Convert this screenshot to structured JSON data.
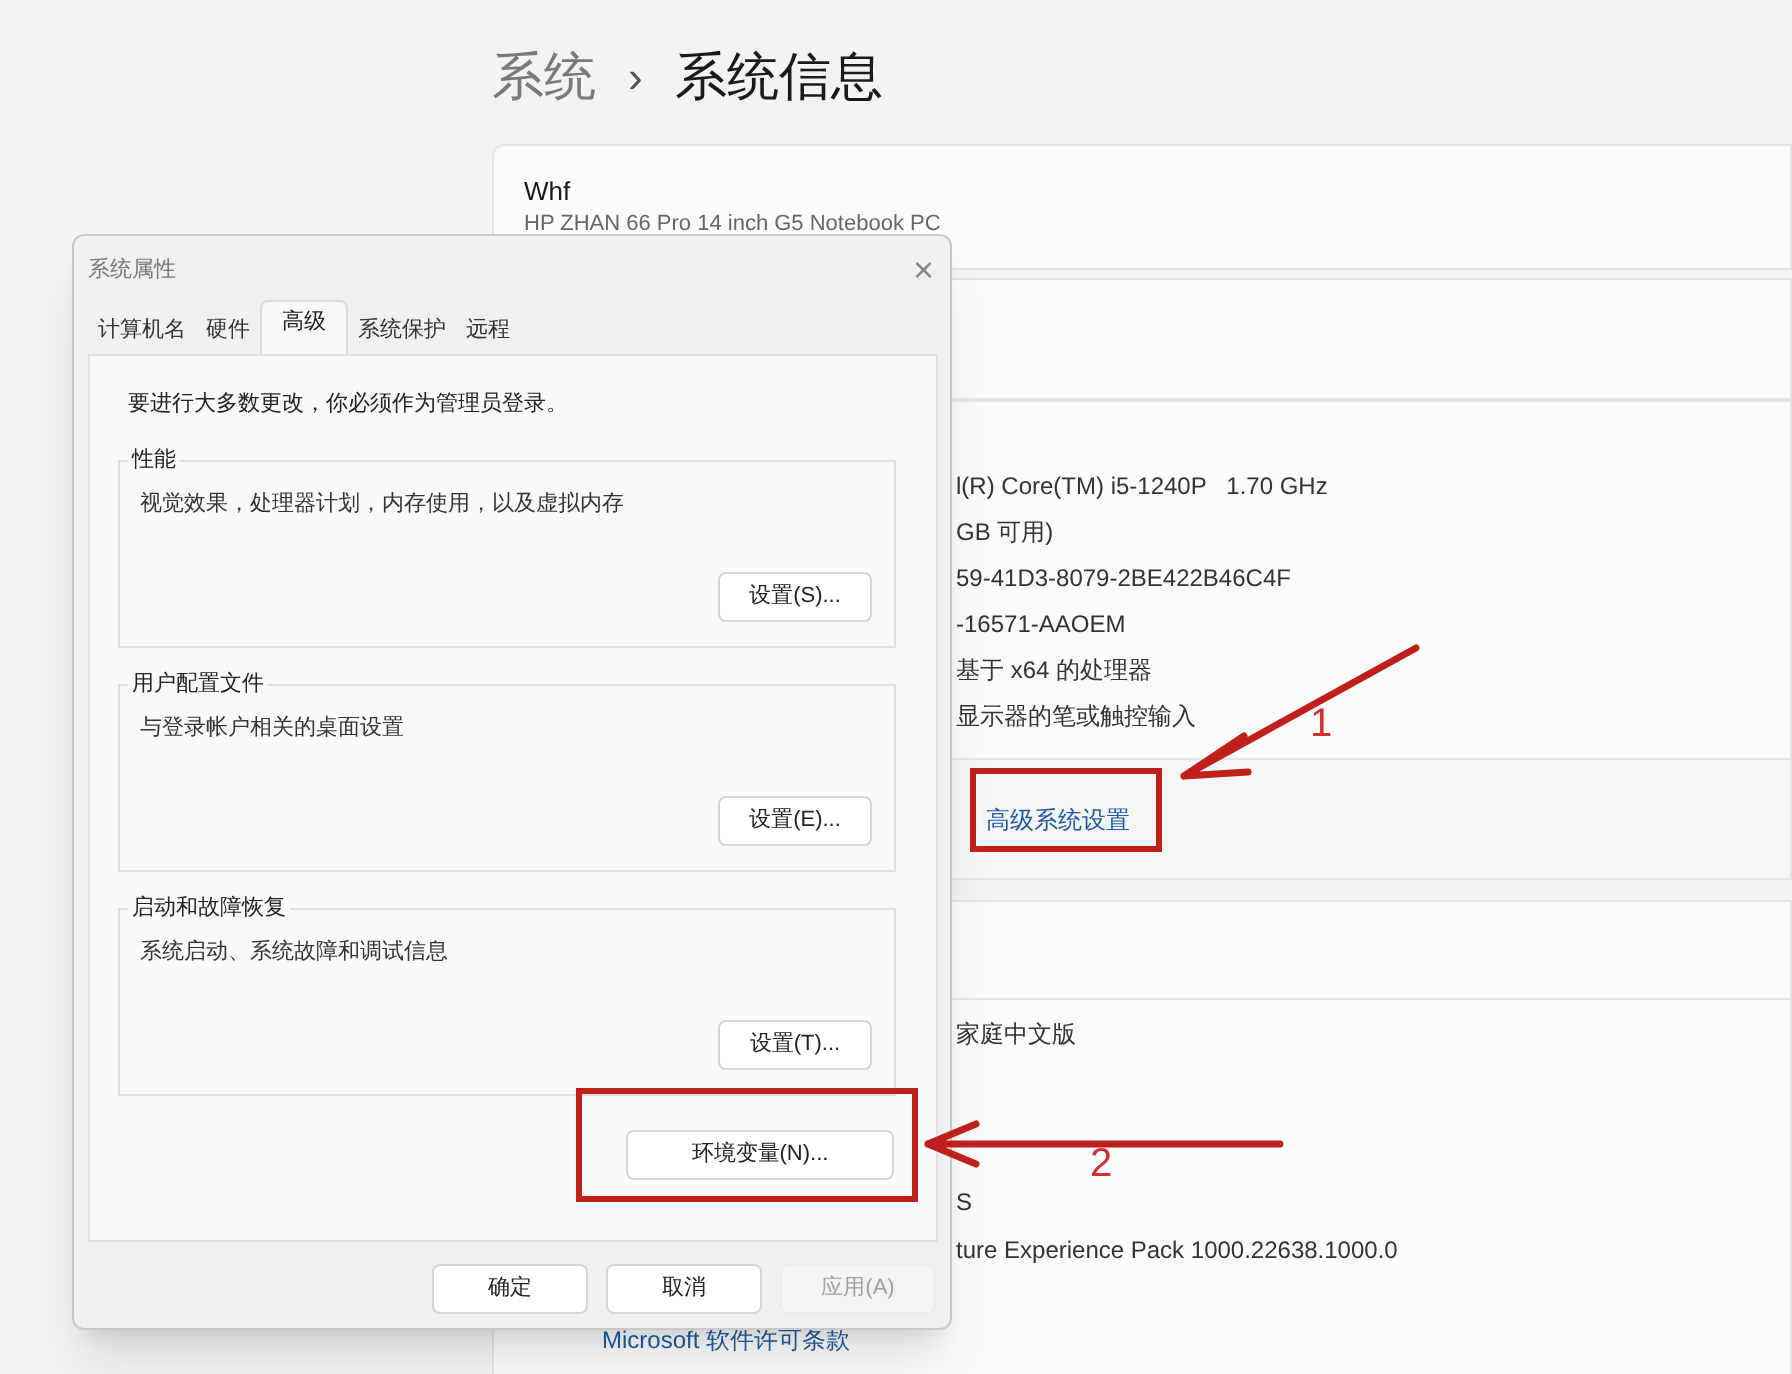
{
  "breadcrumb": {
    "parent": "系统",
    "separator": "›",
    "current": "系统信息"
  },
  "device": {
    "name": "Whf",
    "model": "HP ZHAN 66 Pro 14 inch G5 Notebook PC"
  },
  "specs": [
    "l(R) Core(TM) i5-1240P   1.70 GHz",
    "GB 可用)",
    "59-41D3-8079-2BE422B46C4F",
    "-16571-AAOEM",
    "基于 x64 的处理器",
    "显示器的笔或触控输入"
  ],
  "advanced_link": "高级系统设置",
  "windows_specs": [
    "家庭中文版",
    "S",
    "ture Experience Pack 1000.22638.1000.0"
  ],
  "license_link": "Microsoft 软件许可条款",
  "dialog": {
    "title": "系统属性",
    "close": "×",
    "tabs": [
      {
        "label": "计算机名",
        "selected": false
      },
      {
        "label": "硬件",
        "selected": false
      },
      {
        "label": "高级",
        "selected": true
      },
      {
        "label": "系统保护",
        "selected": false
      },
      {
        "label": "远程",
        "selected": false
      }
    ],
    "notice": "要进行大多数更改，你必须作为管理员登录。",
    "groups": [
      {
        "title": "性能",
        "description": "视觉效果，处理器计划，内存使用，以及虚拟内存",
        "button": "设置(S)..."
      },
      {
        "title": "用户配置文件",
        "description": "与登录帐户相关的桌面设置",
        "button": "设置(E)..."
      },
      {
        "title": "启动和故障恢复",
        "description": "系统启动、系统故障和调试信息",
        "button": "设置(T)..."
      }
    ],
    "env_button": "环境变量(N)...",
    "buttons": [
      {
        "label": "确定",
        "disabled": false
      },
      {
        "label": "取消",
        "disabled": false
      },
      {
        "label": "应用(A)",
        "disabled": true
      }
    ]
  },
  "annotations": [
    {
      "number": "1"
    },
    {
      "number": "2"
    }
  ]
}
